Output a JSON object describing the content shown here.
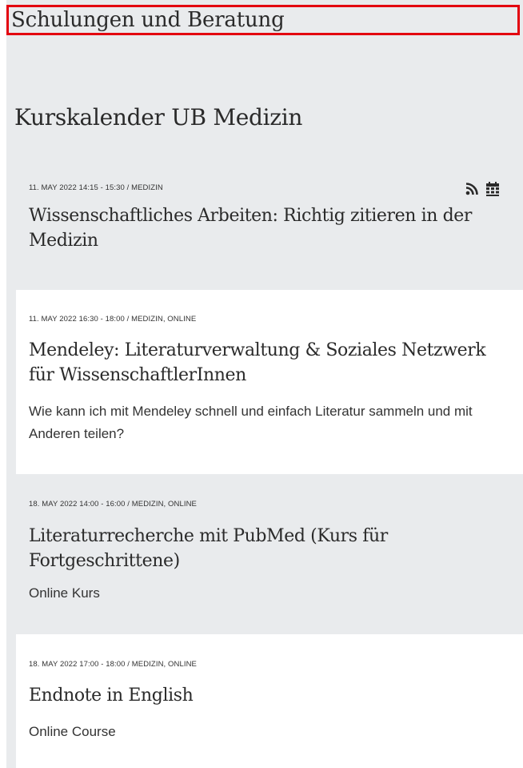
{
  "header": {
    "section_title": "Schulungen und Beratung"
  },
  "calendar": {
    "title": "Kurskalender UB Medizin",
    "icons": {
      "rss": "rss-feed-icon",
      "calendar": "calendar-icon"
    },
    "events": [
      {
        "meta": "11. MAY 2022 14:15 - 15:30 / MEDIZIN",
        "title": "Wissenschaftliches Arbeiten: Richtig zitieren in der Medizin",
        "description": ""
      },
      {
        "meta": "11. MAY 2022 16:30 - 18:00 / MEDIZIN, ONLINE",
        "title": "Mendeley: Literaturverwaltung & Soziales Netzwerk für WissenschaftlerInnen",
        "description": "Wie kann ich mit Mendeley schnell und einfach Literatur sammeln und mit Anderen teilen?"
      },
      {
        "meta": "18. MAY 2022 14:00 - 16:00 / MEDIZIN, ONLINE",
        "title": "Literaturrecherche mit PubMed (Kurs für Fortgeschrittene)",
        "description": "Online Kurs"
      },
      {
        "meta": "18. MAY 2022 17:00 - 18:00 / MEDIZIN, ONLINE",
        "title": "Endnote in English",
        "description": "Online Course"
      }
    ]
  },
  "colors": {
    "highlight_border": "#e3000f",
    "panel_background": "#e9ebed",
    "card_background": "#ffffff",
    "text": "#2a2a2a"
  }
}
